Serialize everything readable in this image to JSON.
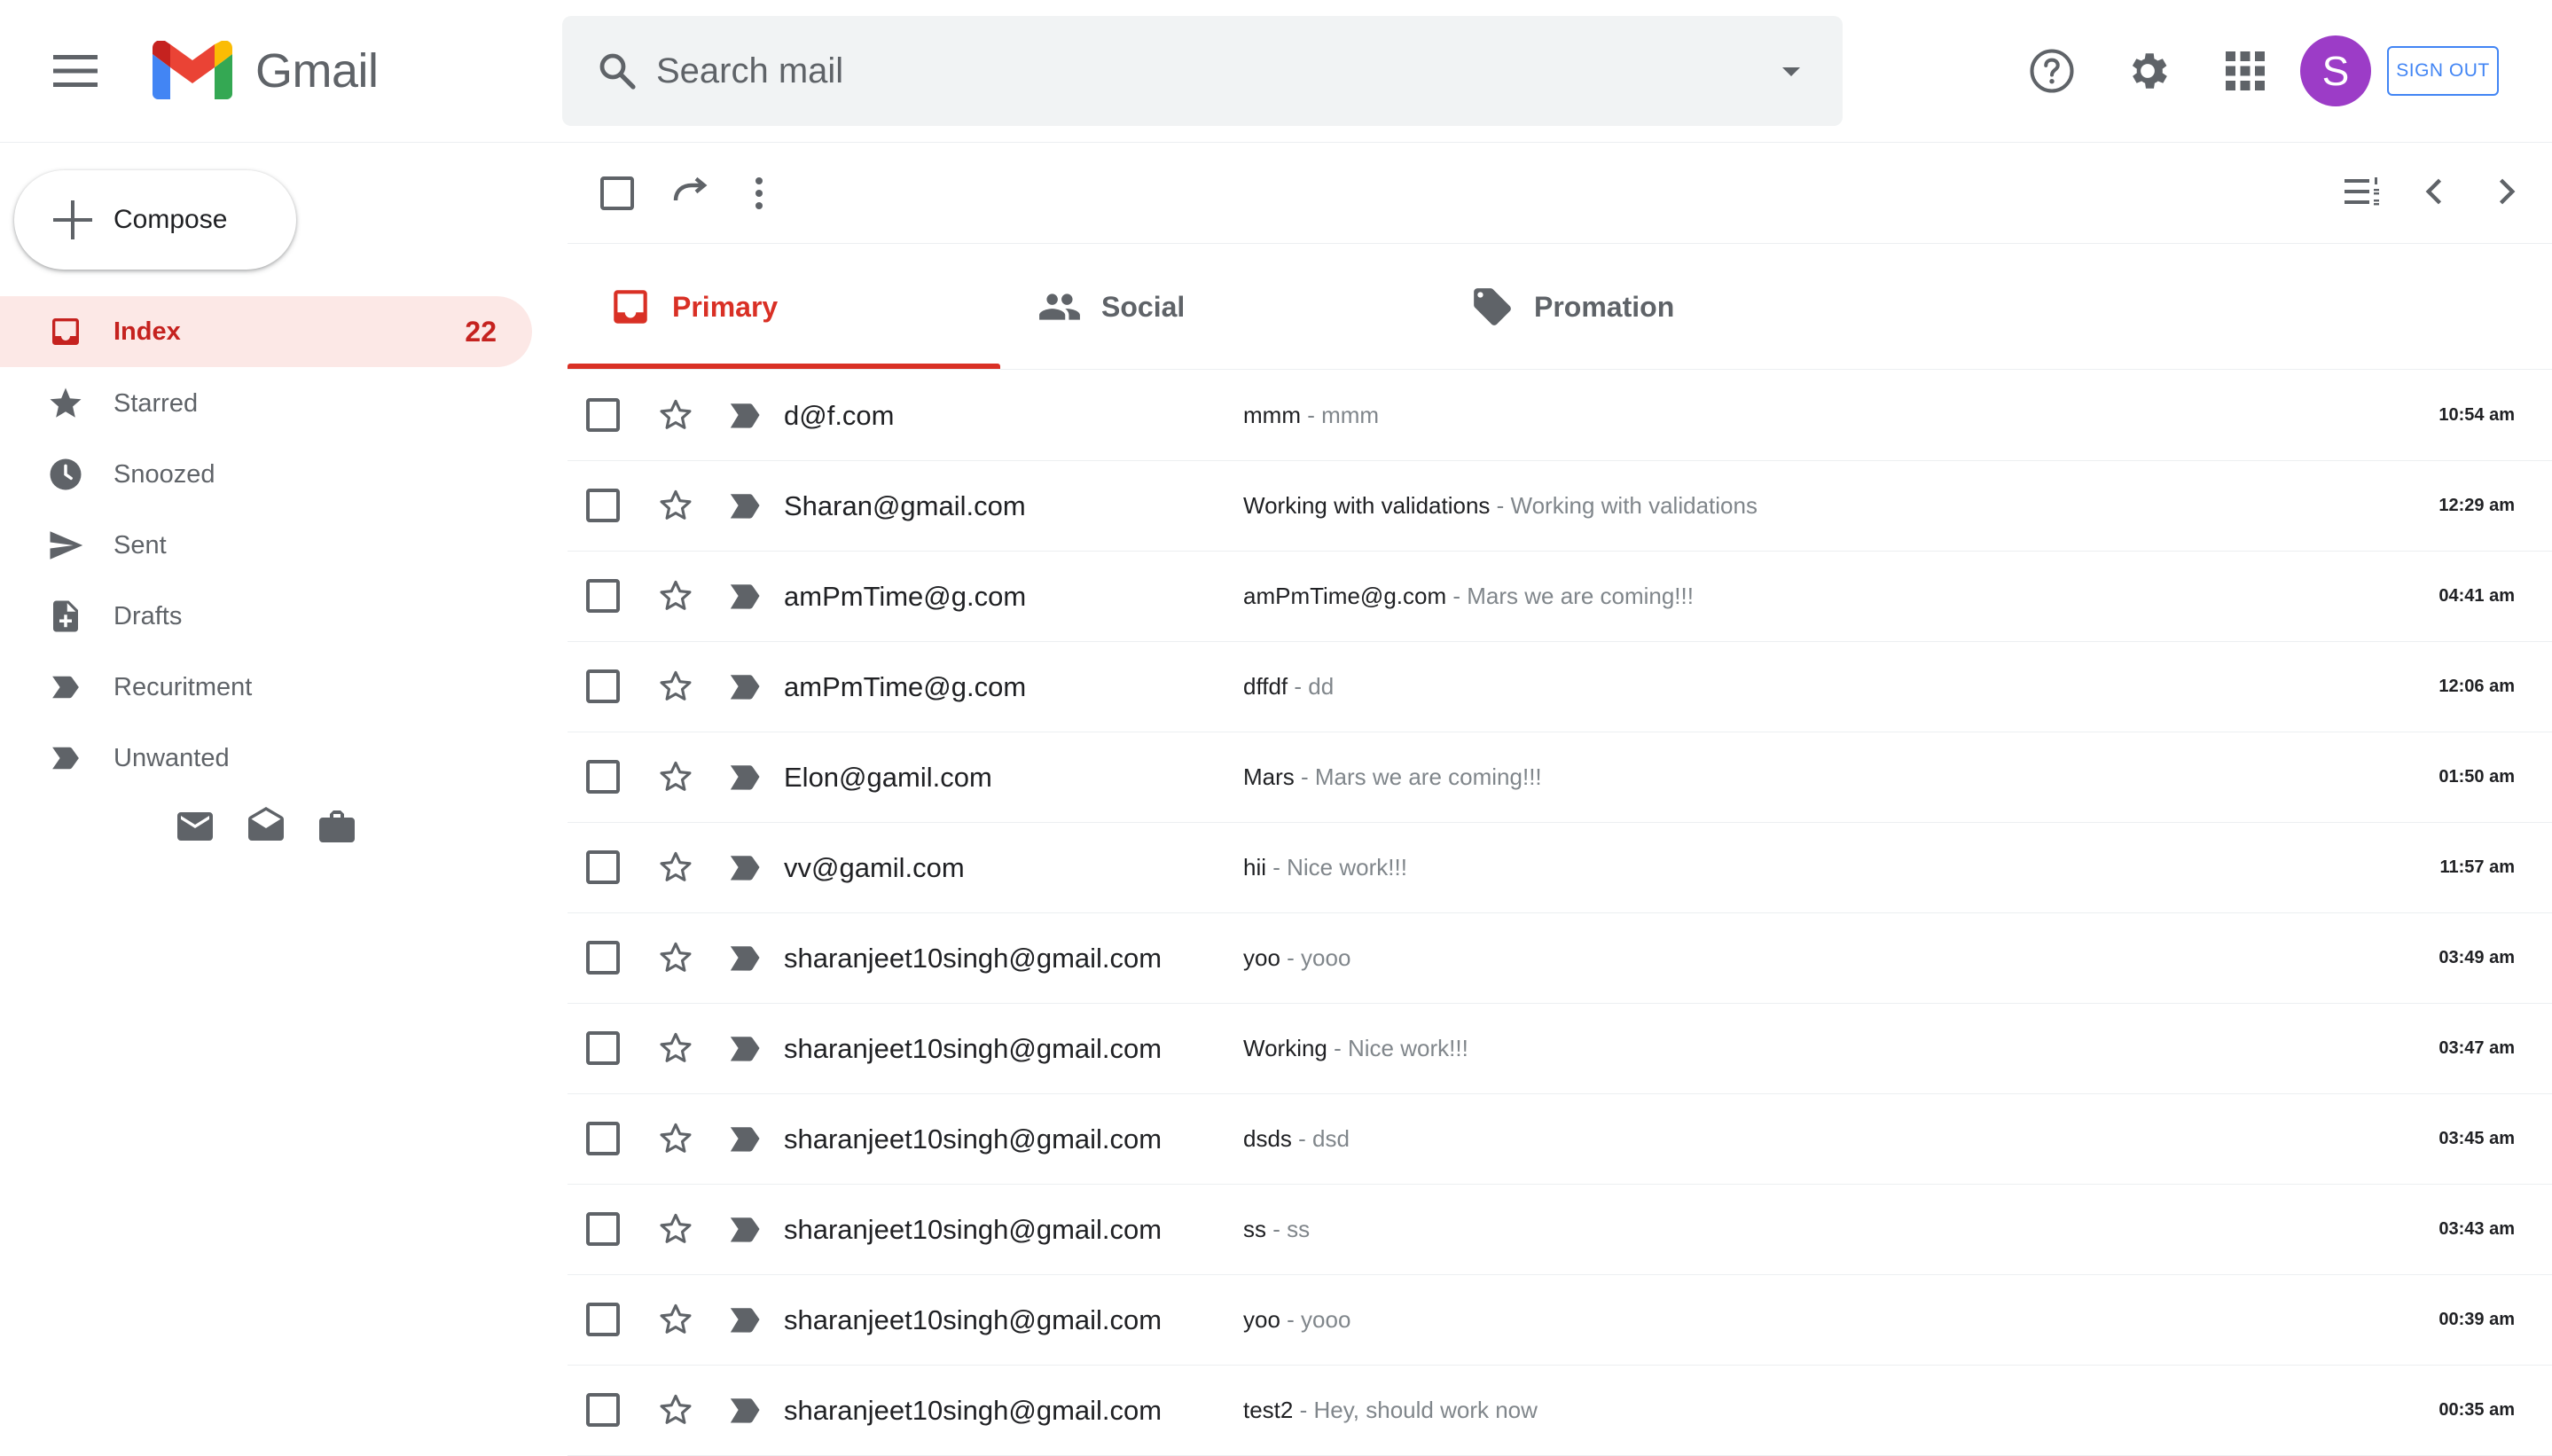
{
  "app": {
    "brand": "Gmail"
  },
  "search": {
    "placeholder": "Search mail"
  },
  "header": {
    "avatar_initial": "S",
    "signout_label": "SIGN OUT"
  },
  "colors": {
    "accent": "#d93025",
    "avatar": "#9c3cc7",
    "signout": "#4285f4",
    "active_bg": "#fce8e6"
  },
  "sidebar": {
    "compose_label": "Compose",
    "items": [
      {
        "label": "Index",
        "icon": "inbox-icon",
        "count": "22",
        "active": true
      },
      {
        "label": "Starred",
        "icon": "star-icon"
      },
      {
        "label": "Snoozed",
        "icon": "clock-icon"
      },
      {
        "label": "Sent",
        "icon": "send-icon"
      },
      {
        "label": "Drafts",
        "icon": "draft-icon"
      },
      {
        "label": "Recuritment",
        "icon": "label-icon"
      },
      {
        "label": "Unwanted",
        "icon": "label-icon"
      }
    ],
    "bottom_icons": [
      "mail-icon",
      "drafts-open-icon",
      "briefcase-icon"
    ]
  },
  "tabs": [
    {
      "label": "Primary",
      "icon": "inbox-icon",
      "active": true
    },
    {
      "label": "Social",
      "icon": "people-icon"
    },
    {
      "label": "Promation",
      "icon": "tag-icon"
    }
  ],
  "emails": [
    {
      "sender": "d@f.com",
      "subject": "mmm",
      "snippet": "mmm",
      "time": "10:54 am"
    },
    {
      "sender": "Sharan@gmail.com",
      "subject": "Working with validations",
      "snippet": "Working with validations",
      "time": "12:29 am"
    },
    {
      "sender": "amPmTime@g.com",
      "subject": "amPmTime@g.com",
      "snippet": "Mars we are coming!!!",
      "time": "04:41 am"
    },
    {
      "sender": "amPmTime@g.com",
      "subject": "dffdf",
      "snippet": "dd",
      "time": "12:06 am"
    },
    {
      "sender": "Elon@gamil.com",
      "subject": "Mars",
      "snippet": "Mars we are coming!!!",
      "time": "01:50 am"
    },
    {
      "sender": "vv@gamil.com",
      "subject": "hii",
      "snippet": "Nice work!!!",
      "time": "11:57 am"
    },
    {
      "sender": "sharanjeet10singh@gmail.com",
      "subject": "yoo",
      "snippet": "yooo",
      "time": "03:49 am"
    },
    {
      "sender": "sharanjeet10singh@gmail.com",
      "subject": "Working",
      "snippet": "Nice work!!!",
      "time": "03:47 am"
    },
    {
      "sender": "sharanjeet10singh@gmail.com",
      "subject": "dsds",
      "snippet": "dsd",
      "time": "03:45 am"
    },
    {
      "sender": "sharanjeet10singh@gmail.com",
      "subject": "ss",
      "snippet": "ss",
      "time": "03:43 am"
    },
    {
      "sender": "sharanjeet10singh@gmail.com",
      "subject": "yoo",
      "snippet": "yooo",
      "time": "00:39 am"
    },
    {
      "sender": "sharanjeet10singh@gmail.com",
      "subject": "test2",
      "snippet": "Hey, should work now",
      "time": "00:35 am"
    }
  ]
}
